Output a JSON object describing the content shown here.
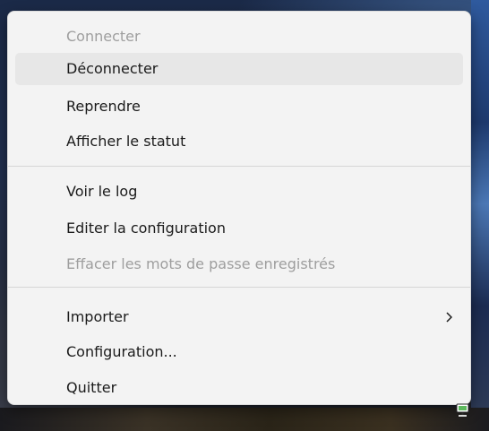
{
  "menu": {
    "groups": [
      {
        "items": [
          {
            "label": "Connecter",
            "enabled": false
          },
          {
            "label": "Déconnecter",
            "enabled": true,
            "hovered": true
          },
          {
            "label": "Reprendre",
            "enabled": true
          },
          {
            "label": "Afficher le statut",
            "enabled": true
          }
        ]
      },
      {
        "items": [
          {
            "label": "Voir le log",
            "enabled": true
          },
          {
            "label": "Editer la configuration",
            "enabled": true
          },
          {
            "label": "Effacer les mots de passe enregistrés",
            "enabled": false
          }
        ]
      },
      {
        "items": [
          {
            "label": "Importer",
            "enabled": true,
            "submenu": true,
            "submenu_icon": "chevron-right-icon"
          },
          {
            "label": "Configuration...",
            "enabled": true
          },
          {
            "label": "Quitter",
            "enabled": true
          }
        ]
      }
    ]
  },
  "tray": {
    "icon": "network-monitor-icon",
    "accent": "#5cb85c"
  },
  "colors": {
    "menu_bg": "#f3f3f3",
    "hover_bg": "#e7e7e7",
    "text": "#1b1b1b",
    "disabled_text": "#9e9e9e"
  }
}
